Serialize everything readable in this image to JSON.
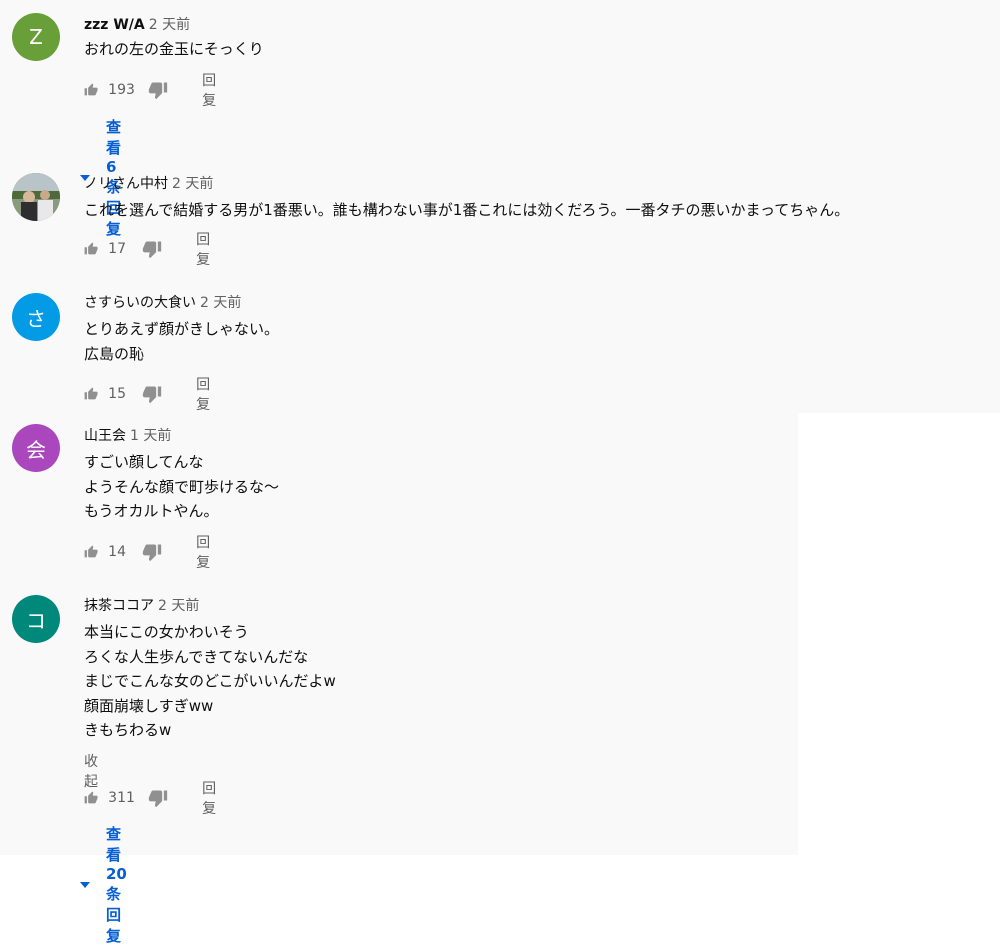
{
  "comments": [
    {
      "avatar_letter": "Z",
      "avatar_color": "#689f38",
      "author": "zzz W/A",
      "time": "2 天前",
      "lines": [
        "おれの左の金玉にそっくり"
      ],
      "likes": "193",
      "reply_label": "回复",
      "view_replies": "查看 6 条回复"
    },
    {
      "avatar_letter": "",
      "avatar_color": "#7a8a70",
      "author": "ノリさん中村",
      "time": "2 天前",
      "lines": [
        "これを選んで結婚する男が1番悪い。誰も構わない事が1番これには効くだろう。一番タチの悪いかまってちゃん。"
      ],
      "likes": "17",
      "reply_label": "回复"
    },
    {
      "avatar_letter": "さ",
      "avatar_color": "#039be5",
      "author": "さすらいの大食い",
      "time": "2 天前",
      "lines": [
        "とりあえず顔がきしゃない。",
        "広島の恥"
      ],
      "likes": "15",
      "reply_label": "回复"
    },
    {
      "avatar_letter": "会",
      "avatar_color": "#ab47bc",
      "author": "山王会",
      "time": "1 天前",
      "lines": [
        "すごい顔してんな",
        "ようそんな顔で町歩けるな〜",
        "もうオカルトやん。"
      ],
      "likes": "14",
      "reply_label": "回复"
    },
    {
      "avatar_letter": "コ",
      "avatar_color": "#00897b",
      "author": "抹茶ココア",
      "time": "2 天前",
      "lines": [
        "本当にこの女かわいそう",
        "ろくな人生歩んできてないんだな",
        "まじでこんな女のどこがいいんだよw",
        "顔面崩壊しすぎww",
        "きもちわるw"
      ],
      "collapse_label": "收起",
      "likes": "311",
      "reply_label": "回复",
      "view_replies": "查看 20 条回复"
    }
  ],
  "icons": {
    "like": "thumbs-up-icon",
    "dislike": "thumbs-down-icon",
    "expand": "caret-down-icon"
  },
  "colors": {
    "link_blue": "#065fd4",
    "secondary_text": "#606060",
    "background": "#f9f9f9"
  }
}
